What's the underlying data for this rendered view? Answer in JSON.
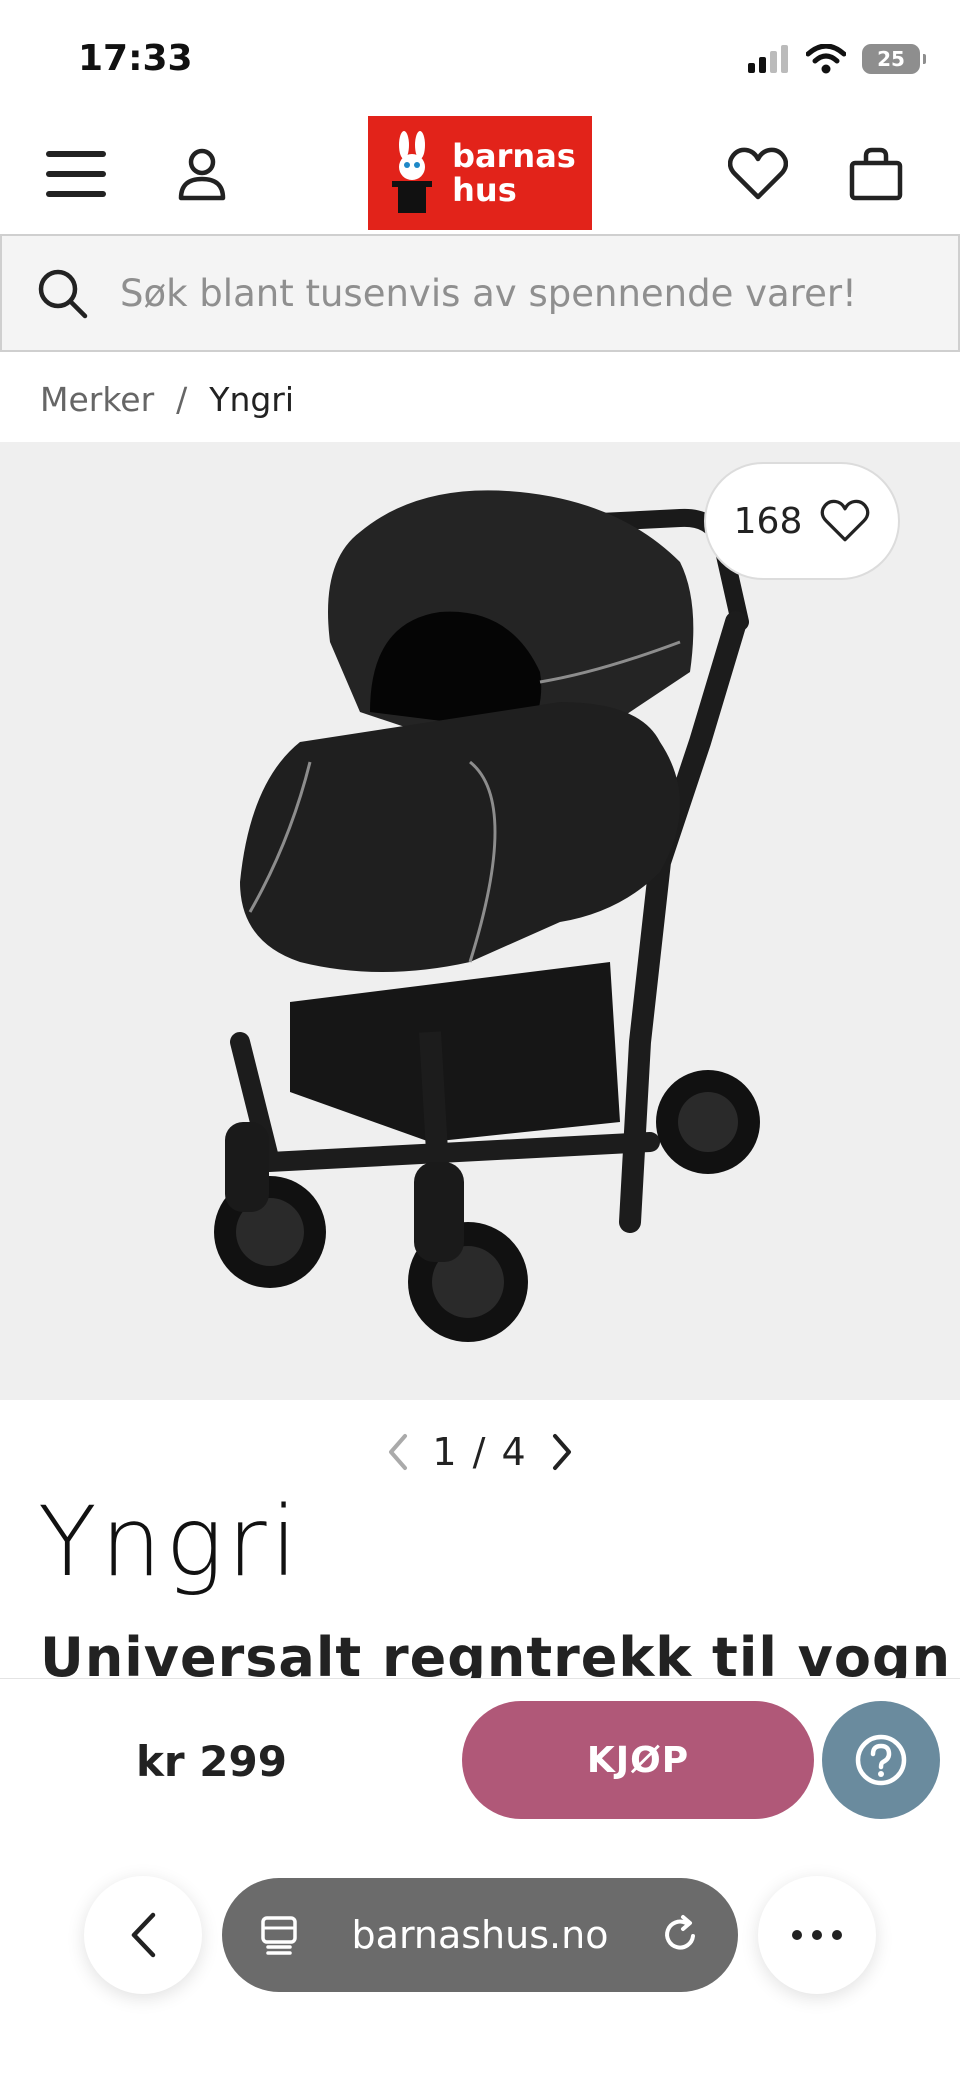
{
  "status": {
    "time": "17:33",
    "battery": "25"
  },
  "header": {
    "logo_line1": "barnas",
    "logo_line2": "hus"
  },
  "search": {
    "placeholder": "Søk blant tusenvis av spennende varer!"
  },
  "breadcrumb": {
    "items": [
      "Merker",
      "Yngri"
    ],
    "separator": "/"
  },
  "product": {
    "likes": "168",
    "pager": "1 / 4",
    "brand": "Yngri",
    "title": "Universalt regntrekk til vogn",
    "price": "kr 299"
  },
  "actions": {
    "buy_label": "KJØP"
  },
  "browser": {
    "url": "barnashus.no"
  },
  "colors": {
    "brand_red": "#e2231a",
    "buy_button": "#b05878",
    "help_button": "#6a8b9e"
  },
  "icons": [
    "menu-icon",
    "user-icon",
    "heart-icon",
    "bag-icon",
    "search-icon",
    "chevron-left-icon",
    "chevron-right-icon",
    "help-icon",
    "tabs-icon",
    "reload-icon",
    "more-icon"
  ]
}
